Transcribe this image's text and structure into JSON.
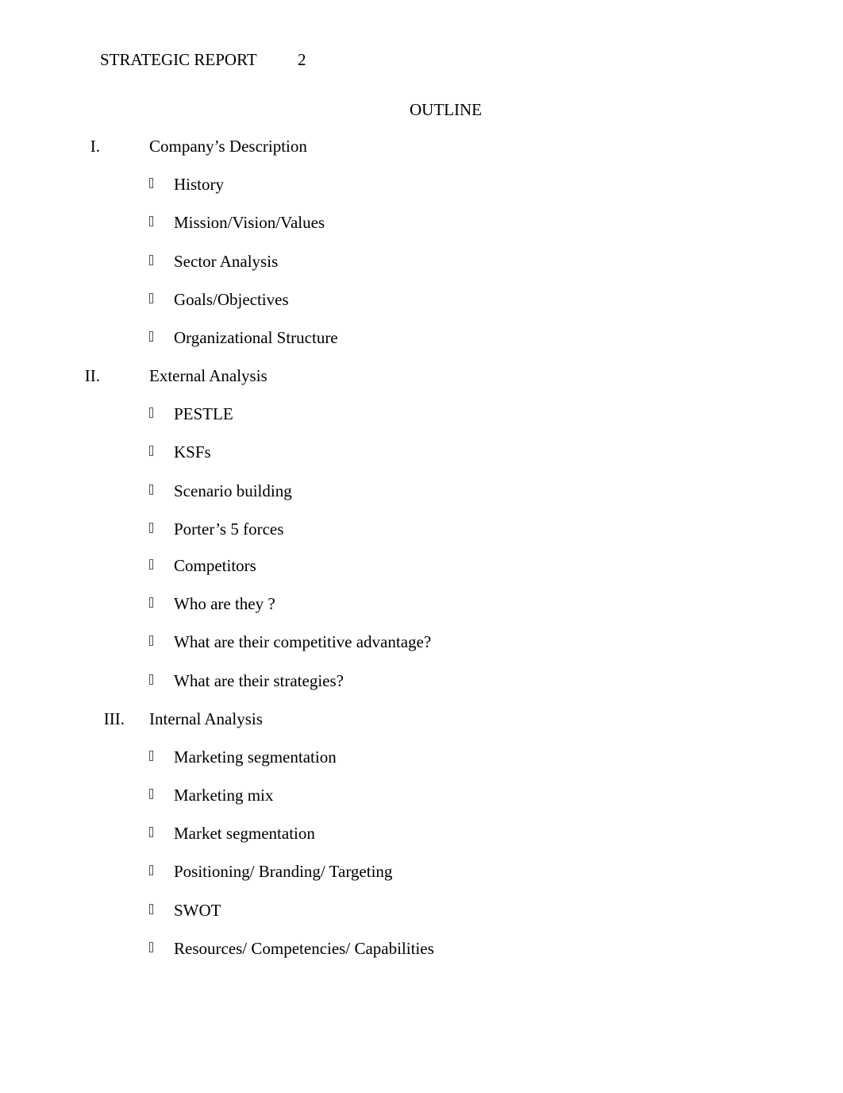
{
  "header": {
    "running_head": "STRATEGIC REPORT",
    "page_number": "2"
  },
  "title": "OUTLINE",
  "sections": [
    {
      "numeral": "I.",
      "heading": "Company’s Description",
      "items": [
        "History",
        "Mission/Vision/Values",
        "Sector Analysis",
        "Goals/Objectives",
        "Organizational Structure"
      ]
    },
    {
      "numeral": "II.",
      "heading": "External Analysis",
      "items": [
        "PESTLE",
        "KSFs",
        "Scenario building",
        "Porter’s 5 forces",
        "Competitors",
        "Who are they ?",
        "What are their competitive advantage?",
        "What are their strategies?"
      ]
    },
    {
      "numeral": "III.",
      "heading": "Internal Analysis",
      "items": [
        "Marketing segmentation",
        "Marketing mix",
        "Market segmentation",
        "Positioning/ Branding/ Targeting",
        "SWOT",
        "Resources/ Competencies/ Capabilities"
      ]
    }
  ],
  "bullet_icon": "missing-glyph-box"
}
